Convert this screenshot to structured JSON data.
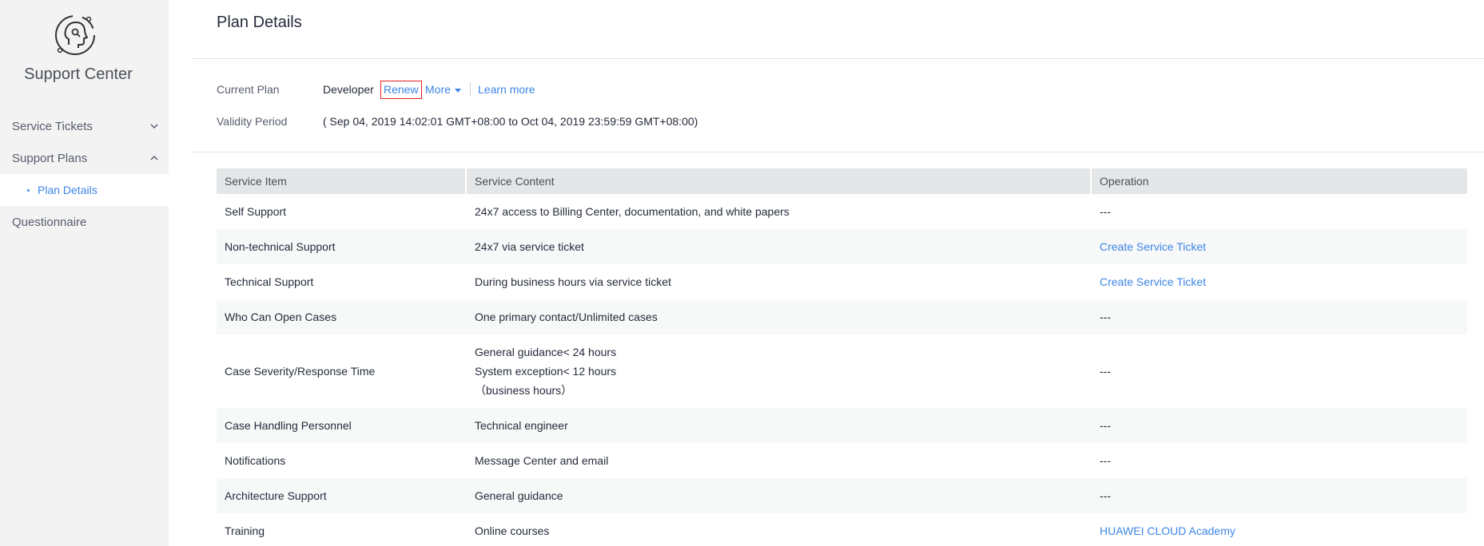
{
  "sidebar": {
    "brand": "Support Center",
    "items": [
      {
        "label": "Service Tickets"
      },
      {
        "label": "Support Plans"
      },
      {
        "label": "Questionnaire"
      }
    ],
    "sub_item": "Plan Details"
  },
  "header": {
    "title": "Plan Details"
  },
  "plan": {
    "current_label": "Current Plan",
    "current_value": "Developer",
    "renew": "Renew",
    "more": "More",
    "learn_more": "Learn more",
    "validity_label": "Validity Period",
    "validity_value": "( Sep 04, 2019 14:02:01 GMT+08:00 to Oct 04, 2019 23:59:59 GMT+08:00)"
  },
  "table": {
    "headers": [
      "Service Item",
      "Service Content",
      "Operation"
    ],
    "rows": [
      {
        "item": "Self Support",
        "content": "24x7 access to Billing Center, documentation, and white papers",
        "op": "---"
      },
      {
        "item": "Non-technical Support",
        "content": "24x7 via service ticket",
        "op": "Create Service Ticket"
      },
      {
        "item": "Technical Support",
        "content": "During business hours via service ticket",
        "op": "Create Service Ticket"
      },
      {
        "item": "Who Can Open Cases",
        "content": "One primary contact/Unlimited cases",
        "op": "---"
      },
      {
        "item": "Case Severity/Response Time",
        "content_lines": [
          "General guidance< 24 hours",
          "System exception< 12 hours",
          "（business hours）"
        ],
        "op": "---"
      },
      {
        "item": "Case Handling Personnel",
        "content": "Technical engineer",
        "op": "---"
      },
      {
        "item": "Notifications",
        "content": "Message Center and email",
        "op": "---"
      },
      {
        "item": "Architecture Support",
        "content": "General guidance",
        "op": "---"
      },
      {
        "item": "Training",
        "content": "Online courses",
        "op": "HUAWEI CLOUD Academy"
      }
    ]
  },
  "colors": {
    "link": "#3d86e6",
    "highlight_border": "#e02020",
    "sidebar_bg": "#f3f3f3"
  }
}
